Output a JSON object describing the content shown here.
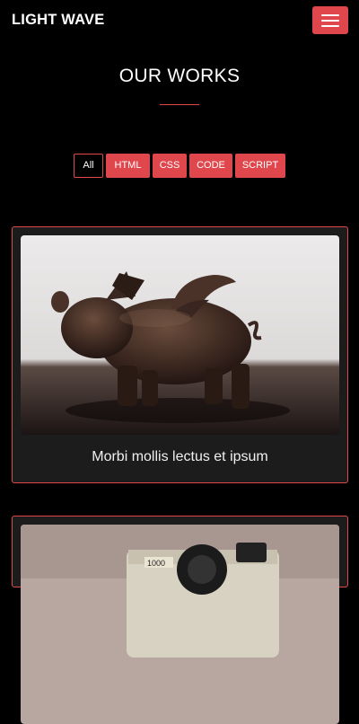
{
  "header": {
    "brand": "LIGHT WAVE",
    "menu_icon": "hamburger-menu-icon",
    "accent_color": "#e0474c"
  },
  "section": {
    "title": "OUR WORKS"
  },
  "filters": [
    {
      "label": "All",
      "active": true
    },
    {
      "label": "HTML",
      "active": false
    },
    {
      "label": "CSS",
      "active": false
    },
    {
      "label": "CODE",
      "active": false
    },
    {
      "label": "SCRIPT",
      "active": false
    }
  ],
  "portfolio": [
    {
      "caption": "Morbi mollis lectus et ipsum",
      "image": "bronze-flying-pig-statue"
    },
    {
      "caption": "",
      "image": "vintage-camera-1000"
    }
  ]
}
